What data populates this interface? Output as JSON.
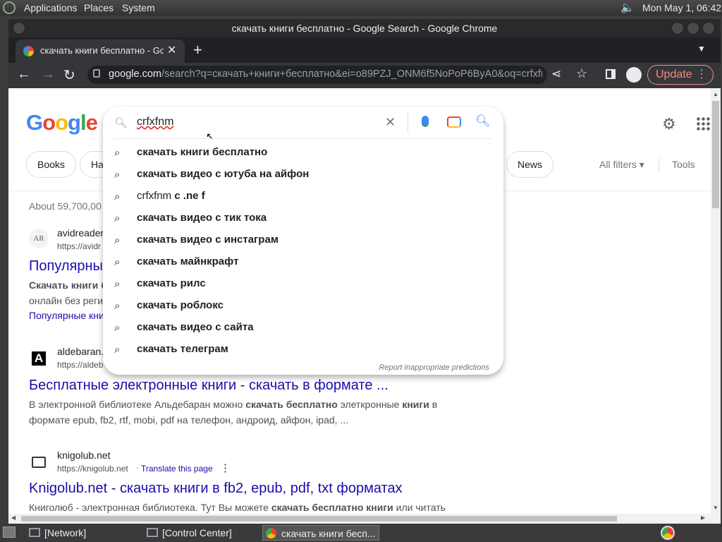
{
  "os_bar": {
    "menus": [
      "Applications",
      "Places",
      "System"
    ],
    "clock": "Mon May  1, 06:42"
  },
  "window": {
    "title": "скачать книги бесплатно - Google Search - Google Chrome"
  },
  "tab": {
    "title": "скачать книги бесплатно - Go"
  },
  "toolbar": {
    "url_host": "google.com",
    "url_rest": "/search?q=скачать+книги+бесплатно&ei=o89PZJ_ONM6f5NoPoP6ByA0&oq=crfxfn...",
    "update_label": "Update"
  },
  "search": {
    "query": "crfxfnm",
    "logo": "Google"
  },
  "chips": [
    "Books",
    "Ha",
    "News"
  ],
  "filters": {
    "all_filters": "All filters",
    "tools": "Tools"
  },
  "about": "About 59,700,00",
  "suggestions": [
    {
      "prefix": "",
      "bold": "скачать книги бесплатно"
    },
    {
      "prefix": "",
      "bold": "скачать видео с ютуба на айфон"
    },
    {
      "prefix": "crfxfnm ",
      "bold": "c .ne f"
    },
    {
      "prefix": "",
      "bold": "скачать видео с тик тока"
    },
    {
      "prefix": "",
      "bold": "скачать видео с инстаграм"
    },
    {
      "prefix": "",
      "bold": "скачать майнкрафт"
    },
    {
      "prefix": "",
      "bold": "скачать рилс"
    },
    {
      "prefix": "",
      "bold": "скачать роблокс"
    },
    {
      "prefix": "",
      "bold": "скачать видео с сайта"
    },
    {
      "prefix": "",
      "bold": "скачать телеграм"
    }
  ],
  "report_text": "Report inappropriate predictions",
  "results": [
    {
      "favicon": "AR",
      "site": "avidreader",
      "url": "https://avidr",
      "title": "Популярны",
      "snip1_bold": "Скачать книги б",
      "snip2": "онлайн без реги",
      "sublink": "Популярные кни"
    },
    {
      "favicon": "A",
      "site": "aldebaran.",
      "url": "https://aldeb",
      "title": "Бесплатные электронные книги - скачать в формате ...",
      "snippet": [
        {
          "t": "В электронной библиотеке Альдебаран можно ",
          "b": false
        },
        {
          "t": "скачать бесплатно",
          "b": true
        },
        {
          "t": " элеткронные ",
          "b": false
        },
        {
          "t": "книги",
          "b": true
        },
        {
          "t": " в",
          "b": false
        }
      ],
      "snippet_line2": "формате epub, fb2, rtf, mobi, pdf на телефон, андроид, айфон, ipad, ..."
    },
    {
      "site": "knigolub.net",
      "url": "https://knigolub.net",
      "translate": "Translate this page",
      "title": "Knigolub.net - скачать книги в fb2, epub, pdf, txt форматах",
      "snippet": [
        {
          "t": "Книголюб - электронная библиотека. Тут Вы можете ",
          "b": false
        },
        {
          "t": "скачать бесплатно книги",
          "b": true
        },
        {
          "t": " или читать",
          "b": false
        }
      ]
    }
  ],
  "taskbar": {
    "items": [
      "[Network]",
      "[Control Center]",
      "скачать книги бесп..."
    ]
  }
}
